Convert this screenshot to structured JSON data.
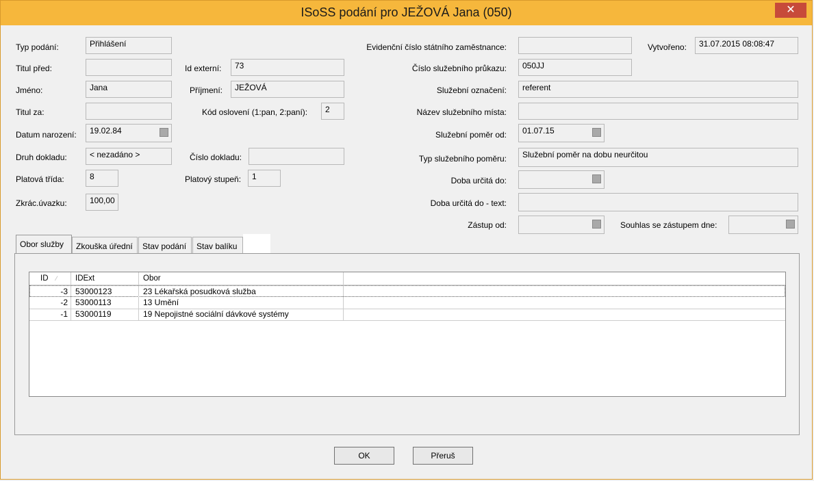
{
  "window": {
    "title": "ISoSS podání pro JEŽOVÁ Jana (050)",
    "close_label": "✕"
  },
  "left": {
    "typ_podani": {
      "label": "Typ podání:",
      "value": "Přihlášení"
    },
    "titul_pred": {
      "label": "Titul před:",
      "value": ""
    },
    "jmeno": {
      "label": "Jméno:",
      "value": "Jana"
    },
    "titul_za": {
      "label": "Titul za:",
      "value": ""
    },
    "datum_narozeni": {
      "label": "Datum narození:",
      "value": "19.02.84"
    },
    "druh_dokladu": {
      "label": "Druh dokladu:",
      "value": "< nezadáno >"
    },
    "platova_trida": {
      "label": "Platová třída:",
      "value": "8"
    },
    "zkrac_uvazku": {
      "label": "Zkrác.úvazku:",
      "value": "100,00"
    }
  },
  "middle": {
    "id_externi": {
      "label": "Id externí:",
      "value": "73"
    },
    "prijmeni": {
      "label": "Příjmení:",
      "value": "JEŽOVÁ"
    },
    "kod_osloveni": {
      "label": "Kód oslovení (1:pan, 2:paní):",
      "value": "2"
    },
    "cislo_dokladu": {
      "label": "Číslo dokladu:",
      "value": ""
    },
    "platovy_stupen": {
      "label": "Platový stupeň:",
      "value": "1"
    }
  },
  "right": {
    "evidencni_cislo": {
      "label": "Evidenční číslo státního zaměstnance:",
      "value": ""
    },
    "vytvoreno": {
      "label": "Vytvořeno:",
      "value": "31.07.2015 08:08:47"
    },
    "cislo_prukazu": {
      "label": "Číslo služebního průkazu:",
      "value": "050JJ"
    },
    "sluzebni_oznaceni": {
      "label": "Služební označení:",
      "value": "referent"
    },
    "nazev_mista": {
      "label": "Název služebního místa:",
      "value": ""
    },
    "sluzebni_pomer_od": {
      "label": "Služební poměr od:",
      "value": "01.07.15"
    },
    "typ_pomeru": {
      "label": "Typ služebního poměru:",
      "value": "Služební poměr na dobu neurčitou"
    },
    "doba_urcita_do": {
      "label": "Doba určitá do:",
      "value": ""
    },
    "doba_urcita_text": {
      "label": "Doba určitá do - text:",
      "value": ""
    },
    "zastup_od": {
      "label": "Zástup od:",
      "value": ""
    },
    "souhlas": {
      "label": "Souhlas se zástupem dne:",
      "value": ""
    }
  },
  "tabs": [
    {
      "label": "Obor služby",
      "active": true
    },
    {
      "label": "Zkouška úřední"
    },
    {
      "label": "Stav podání"
    },
    {
      "label": "Stav balíku"
    }
  ],
  "grid": {
    "columns": [
      "ID",
      "IDExt",
      "Obor"
    ],
    "sort_indicator": "⁄",
    "rows": [
      {
        "id": "-3",
        "idext": "53000123",
        "obor": "23 Lékařská posudková služba"
      },
      {
        "id": "-2",
        "idext": "53000113",
        "obor": "13 Umění"
      },
      {
        "id": "-1",
        "idext": "53000119",
        "obor": "19 Nepojistné sociální dávkové systémy"
      }
    ]
  },
  "buttons": {
    "ok": "OK",
    "cancel": "Přeruš"
  }
}
